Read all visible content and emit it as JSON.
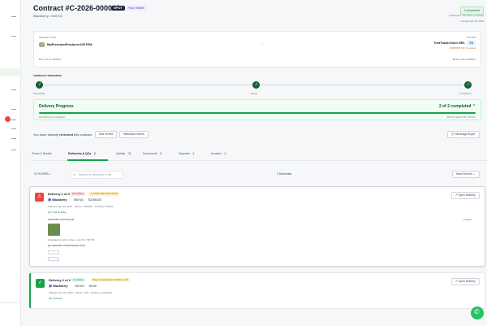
{
  "colors": {
    "accent": "#16a34a",
    "danger": "#dc2626",
    "seller": "#6d28d9"
  },
  "header": {
    "title": "Contract #C-2026-000010",
    "badge_type": "SPOT",
    "badge_role": "You: Seller",
    "product_line": "Blackberry • 500 KG",
    "status": "Completed",
    "deliveries_summary": "2 deliveries • 60 Total • complete",
    "created": "Created Apr 20, 2026"
  },
  "parties": {
    "seller_label": "SELLER (YOU)",
    "seller_name": "MyPremiumProducer100 PFA",
    "buyer_label": "BUYER",
    "buyer_name": "TestTraderJohn SRL",
    "buyer_initials": "TS",
    "buyer_rating": "★★★★★ 5.0 / 1 review",
    "arrow": "→",
    "seller_id": "⇄ Ind.ALCT-938340",
    "buyer_id": "⇄ ROJ-AR-0-908231"
  },
  "progress": {
    "section_title": "CONTRACT PROGRESS",
    "steps": [
      {
        "label": "Scheduled"
      },
      {
        "label": "Active"
      },
      {
        "label": "Completed"
      }
    ]
  },
  "delivery_progress": {
    "title": "Delivery Progress",
    "count": "2 of 2 completed ⌃",
    "fraction": 1.0,
    "left_note": "All deliveries completed",
    "right_note": "400 KG paid of 60 / 60 KG"
  },
  "review": {
    "text_prefix": "You have already",
    "text_bold": "reviewed",
    "text_suffix": "this contract.",
    "edit_label": "Edit review",
    "withdraw_label": "Withdraw review",
    "message_label": "💬 Message Buyer"
  },
  "tabs": [
    {
      "label": "Terms & Details",
      "count": ""
    },
    {
      "label": "Deliveries & QCs",
      "count": "2"
    },
    {
      "label": "Activity",
      "count": "74"
    },
    {
      "label": "Documents",
      "count": "0"
    },
    {
      "label": "Disputes",
      "count": "1"
    },
    {
      "label": "Invoices",
      "count": "1"
    }
  ],
  "filters": {
    "filters_label": "⚲ FILTERS ⌄",
    "search_placeholder": "Search by delivery# or file",
    "count_label": "2 Deliveries",
    "sort_label": "Most Recent ⌄"
  },
  "delivery1": {
    "title": "Delivery 1 of 2",
    "status_pill": "QC Failed",
    "dispute_pill": "⚠ DISPUTED (RE-TEST)",
    "product": "🫐 Blackberry",
    "qty": "500 KG",
    "price": "€2,900.00",
    "shipped": "Shipped: Apr 20, 2026 · Carrier: 2345445 · Tracking: 334234",
    "qc_line": "QC: Full lot Pass",
    "section_label": "SHIPPING PHOTOS (2)",
    "right_label": "Loaded",
    "uploaded": "Uploaded by Admin User • Apr 20, 7:55 PM",
    "qc_report": "QC REPORT FROM INSPECTOR",
    "open_label": "↗ Open delivery"
  },
  "delivery2": {
    "title": "Delivery 2 of 2",
    "status_pill": "Complete",
    "note_pill": "Buyer accepted all of Delivery #2",
    "product": "🫐 Blackberry",
    "qty": "100 KG",
    "price": "€0.00",
    "shipped": "Shipped: Apr 20, 2026 · Carrier: asdf · Tracking: asdf2asdf",
    "qc_line": "QC: Passed",
    "open_label": "↗ Open delivery"
  },
  "icons": {
    "whatsapp": "whatsapp-icon",
    "search": "search-icon",
    "alert": "alert-triangle-icon",
    "check": "check-icon"
  }
}
